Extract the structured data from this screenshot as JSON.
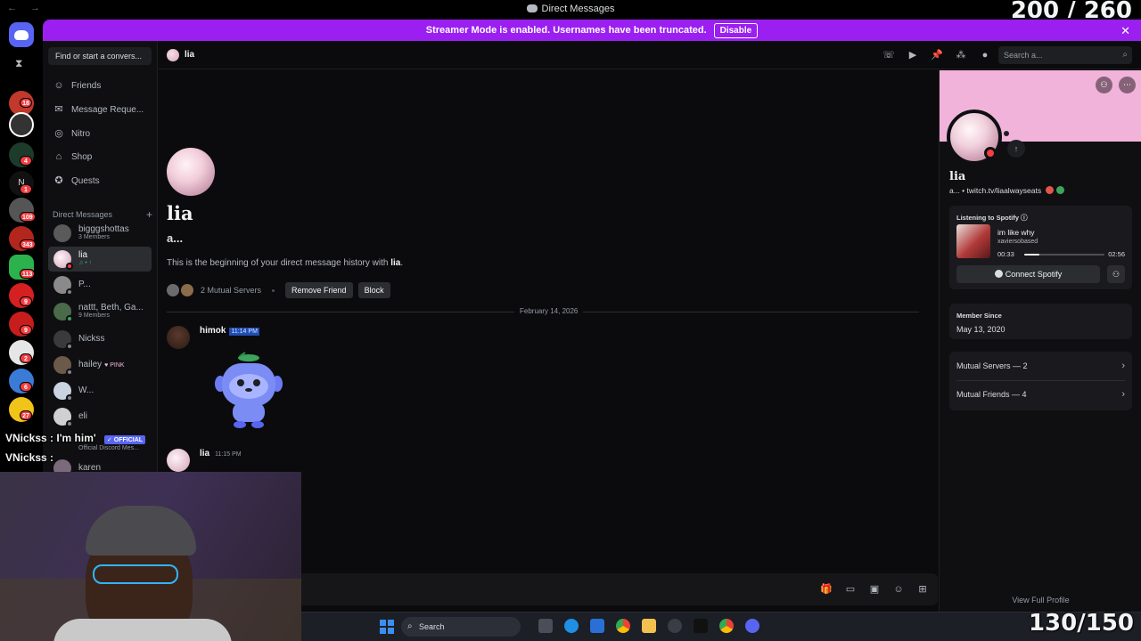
{
  "window": {
    "title": "Direct Messages",
    "nav_arrows": "← →",
    "overlay_top": "200 / 260",
    "overlay_bottom": "130/150"
  },
  "rail": {
    "badges": [
      "18",
      "4",
      "1",
      "109",
      "343",
      "113",
      "9",
      "9",
      "2",
      "6",
      "27"
    ]
  },
  "banner": {
    "text": "Streamer Mode is enabled. Usernames have been truncated.",
    "disable_label": "Disable"
  },
  "sidebar": {
    "find_placeholder": "Find or start a convers...",
    "nav": [
      {
        "label": "Friends",
        "icon": "friends-icon"
      },
      {
        "label": "Message Reque...",
        "icon": "message-requests-icon"
      },
      {
        "label": "Nitro",
        "icon": "nitro-icon"
      },
      {
        "label": "Shop",
        "icon": "shop-icon"
      },
      {
        "label": "Quests",
        "icon": "quests-icon"
      }
    ],
    "dm_header": "Direct Messages",
    "dms": [
      {
        "name": "bigggshottas",
        "sub": "3 Members"
      },
      {
        "name": "lia",
        "sub": "♫ • ↑"
      },
      {
        "name": "P...",
        "sub": ""
      },
      {
        "name": "nattt, Beth, Ga...",
        "sub": "9 Members"
      },
      {
        "name": "Nickss",
        "sub": ""
      },
      {
        "name": "hailey",
        "sub": "",
        "tag": "♥ PINK"
      },
      {
        "name": "W...",
        "sub": ""
      },
      {
        "name": "eli",
        "sub": ""
      },
      {
        "name": "karen",
        "sub": ""
      }
    ]
  },
  "header": {
    "name": "lia",
    "search_placeholder": "Search a..."
  },
  "chat": {
    "name": "lia",
    "subname": "a...",
    "beginning_prefix": "This is the beginning of your direct message history with ",
    "beginning_name": "lia",
    "mutual_servers": "2 Mutual Servers",
    "remove_friend": "Remove Friend",
    "block": "Block",
    "date_divider": "February 14, 2026",
    "messages": [
      {
        "author": "himok",
        "time": "11:14 PM"
      },
      {
        "author": "lia",
        "time": "11:15 PM"
      }
    ]
  },
  "profile": {
    "name": "lia",
    "link": "a... • twitch.tv/liaalwayseats",
    "spotify_title": "Listening to Spotify",
    "song": "im like why",
    "artist": "xaviersobased",
    "time_start": "00:33",
    "time_end": "02:56",
    "progress": 0.19,
    "connect_label": "Connect Spotify",
    "member_since_title": "Member Since",
    "member_since": "May 13, 2020",
    "mutual_servers": "Mutual Servers — 2",
    "mutual_friends": "Mutual Friends — 4",
    "view_full": "View Full Profile"
  },
  "taskbar": {
    "search_label": "Search"
  },
  "stream_chat": {
    "line1": "VNickss : I'm him'",
    "line2": "VNickss :",
    "official_badge": "✓ OFFICIAL",
    "official_sub": "Official Discord Mes..."
  },
  "colors": {
    "streamer_banner": "#9b1ff0",
    "blurple": "#5865f2",
    "profile_banner": "#f2b3da",
    "dnd": "#f23f43"
  }
}
